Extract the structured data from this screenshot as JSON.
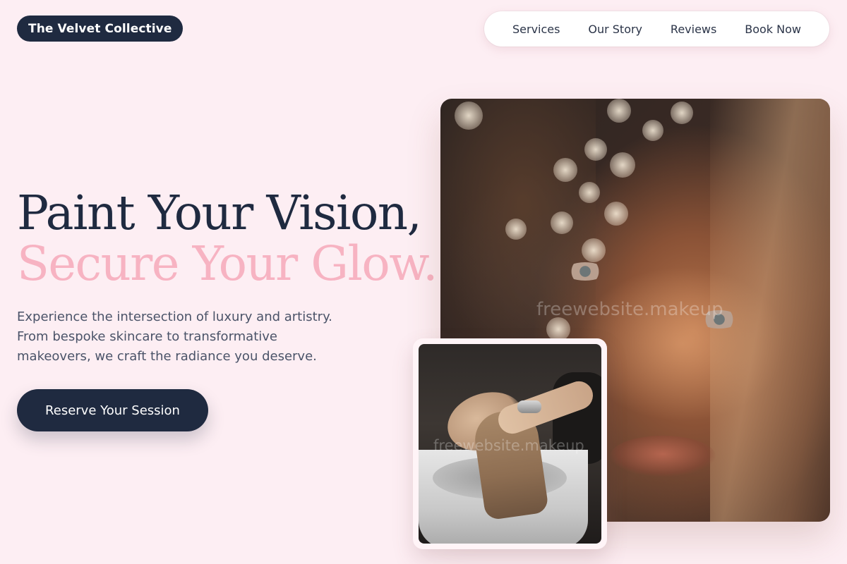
{
  "brand": {
    "name": "The Velvet Collective"
  },
  "nav": {
    "items": [
      {
        "label": "Services"
      },
      {
        "label": "Our Story"
      },
      {
        "label": "Reviews"
      },
      {
        "label": "Book Now"
      }
    ]
  },
  "hero": {
    "headline_line1": "Paint Your Vision,",
    "headline_line2": "Secure Your Glow.",
    "lead": "Experience the intersection of luxury and artistry. From bespoke skincare to transformative makeovers, we craft the radiance you deserve.",
    "cta_label": "Reserve Your Session"
  },
  "images": {
    "portrait_watermark": "freewebsite.makeup",
    "salon_watermark": "freewebsite.makeup"
  },
  "colors": {
    "background": "#fdeef3",
    "navy": "#1f2a40",
    "pink_accent": "#f7b3c2",
    "body_text": "#4a5368"
  }
}
